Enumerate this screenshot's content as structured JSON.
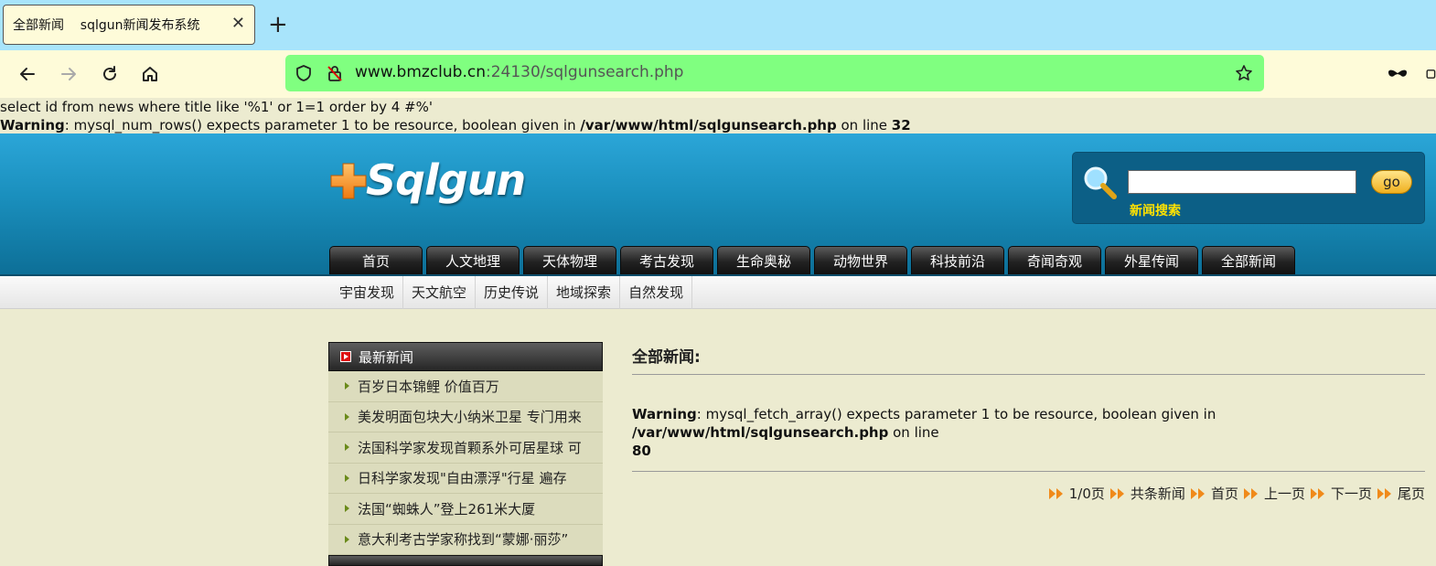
{
  "browser": {
    "tab_title": "全部新闻    sqlgun新闻发布系统",
    "url_host": "www.bmzclub.cn",
    "url_rest": ":24130/sqlgunsearch.php"
  },
  "debug": {
    "sql": "select id from news where title like '%1' or 1=1 order by 4 #%'",
    "warning_label": "Warning",
    "warning_msg": ": mysql_num_rows() expects parameter 1 to be resource, boolean given in ",
    "warning_path": "/var/www/html/sqlgunsearch.php",
    "warning_on_line": " on line ",
    "warning_line": "32"
  },
  "header": {
    "logo_text": "Sqlgun",
    "search_button": "go",
    "search_label": "新闻搜索"
  },
  "main_nav": [
    "首页",
    "人文地理",
    "天体物理",
    "考古发现",
    "生命奥秘",
    "动物世界",
    "科技前沿",
    "奇闻奇观",
    "外星传闻",
    "全部新闻"
  ],
  "sub_nav": [
    "宇宙发现",
    "天文航空",
    "历史传说",
    "地域探索",
    "自然发现"
  ],
  "sidebar": {
    "title": "最新新闻",
    "items": [
      "百岁日本锦鲤 价值百万",
      "美发明面包块大小纳米卫星 专门用来",
      "法国科学家发现首颗系外可居星球 可",
      "日科学家发现\"自由漂浮\"行星 遍存",
      "法国“蜘蛛人”登上261米大厦",
      "意大利考古学家称找到“蒙娜·丽莎”"
    ]
  },
  "content": {
    "title": "全部新闻:",
    "warning_label": "Warning",
    "warning_msg": ": mysql_fetch_array() expects parameter 1 to be resource, boolean given in ",
    "warning_path": "/var/www/html/sqlgunsearch.php",
    "warning_on_line": " on line",
    "warning_line": "80",
    "pager": [
      "1/0页",
      "共条新闻",
      "首页",
      "上一页",
      "下一页",
      "尾页"
    ]
  },
  "colors": {
    "tabbar": "#a8e4fb",
    "toolbar": "#fefbd9",
    "urlbar": "#80ff80",
    "header": "#1a8fbd",
    "page_bg": "#ecebd0"
  }
}
